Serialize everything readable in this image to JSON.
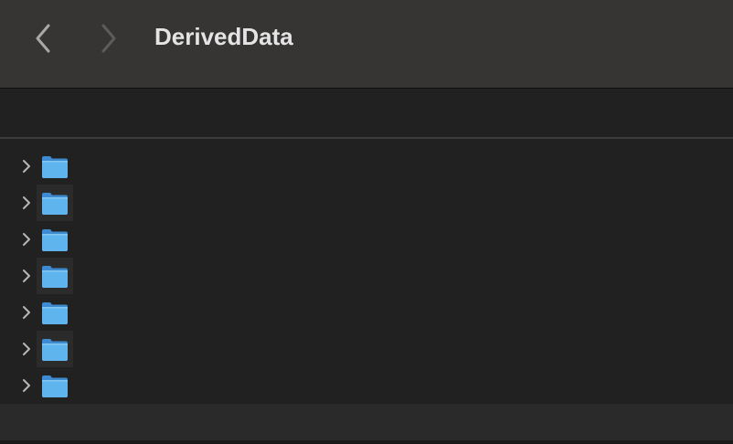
{
  "window": {
    "title": "DerivedData"
  },
  "toolbar": {
    "back_icon": "chevron-left-icon",
    "forward_icon": "chevron-right-icon"
  },
  "colors": {
    "toolbar_bg": "#363534",
    "content_bg": "#222121",
    "folder_blue": "#5fb4ee",
    "title_text": "#e4e4e4"
  },
  "rows": [
    {
      "name": "",
      "icon": "folder-icon",
      "expand_icon": "disclosure-chevron-icon"
    },
    {
      "name": "",
      "icon": "folder-icon",
      "expand_icon": "disclosure-chevron-icon"
    },
    {
      "name": "",
      "icon": "folder-icon",
      "expand_icon": "disclosure-chevron-icon"
    },
    {
      "name": "",
      "icon": "folder-icon",
      "expand_icon": "disclosure-chevron-icon"
    },
    {
      "name": "",
      "icon": "folder-icon",
      "expand_icon": "disclosure-chevron-icon"
    },
    {
      "name": "",
      "icon": "folder-icon",
      "expand_icon": "disclosure-chevron-icon"
    },
    {
      "name": "",
      "icon": "folder-icon",
      "expand_icon": "disclosure-chevron-icon"
    }
  ]
}
